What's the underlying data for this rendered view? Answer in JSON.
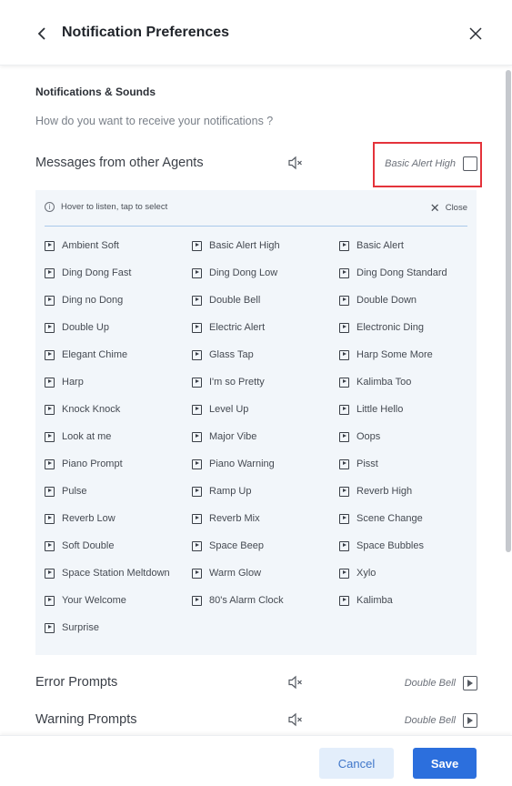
{
  "header": {
    "title": "Notification Preferences"
  },
  "section": {
    "title": "Notifications & Sounds",
    "question": "How do you want to receive your notifications ?"
  },
  "rows": [
    {
      "label": "Messages from other Agents",
      "sound": "Basic Alert High"
    },
    {
      "label": "Error Prompts",
      "sound": "Double Bell"
    },
    {
      "label": "Warning Prompts",
      "sound": "Double Bell"
    }
  ],
  "picker": {
    "hint": "Hover to listen, tap to select",
    "close_label": "Close",
    "sounds": [
      "Ambient Soft",
      "Basic Alert High",
      "Basic Alert",
      "Ding Dong Fast",
      "Ding Dong Low",
      "Ding Dong Standard",
      "Ding no Dong",
      "Double Bell",
      "Double Down",
      "Double Up",
      "Electric Alert",
      "Electronic Ding",
      "Elegant Chime",
      "Glass Tap",
      "Harp Some More",
      "Harp",
      "I'm so Pretty",
      "Kalimba Too",
      "Knock Knock",
      "Level Up",
      "Little Hello",
      "Look at me",
      "Major Vibe",
      "Oops",
      "Piano Prompt",
      "Piano Warning",
      "Pisst",
      "Pulse",
      "Ramp Up",
      "Reverb High",
      "Reverb Low",
      "Reverb Mix",
      "Scene Change",
      "Soft Double",
      "Space Beep",
      "Space Bubbles",
      "Space Station Meltdown",
      "Warm Glow",
      "Xylo",
      "Your Welcome",
      "80's Alarm Clock",
      "Kalimba",
      "Surprise"
    ]
  },
  "footer": {
    "cancel_label": "Cancel",
    "save_label": "Save"
  },
  "colors": {
    "accent": "#2c6fdd",
    "highlight": "#e4333b",
    "picker_bg": "#f2f6fa"
  }
}
